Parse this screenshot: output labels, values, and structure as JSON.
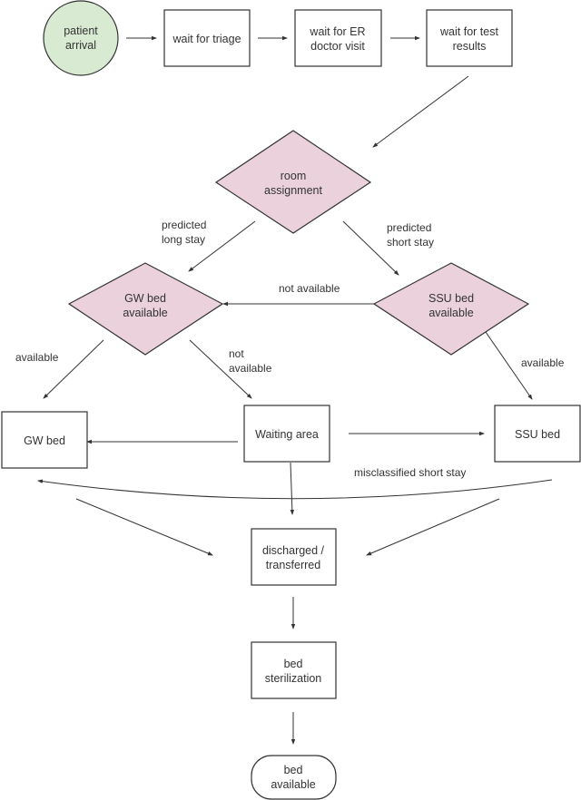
{
  "colors": {
    "start_fill": "#d9ead3",
    "decision_fill": "#ead1dc",
    "process_fill": "#ffffff",
    "stroke": "#333333"
  },
  "nodes": {
    "patient_arrival": [
      "patient",
      "arrival"
    ],
    "wait_triage": [
      "wait for triage"
    ],
    "wait_er": [
      "wait for ER",
      "doctor visit"
    ],
    "wait_test": [
      "wait for test",
      "results"
    ],
    "room_assignment": [
      "room",
      "assignment"
    ],
    "gw_bed_available": [
      "GW bed",
      "available"
    ],
    "ssu_bed_available": [
      "SSU bed",
      "available"
    ],
    "gw_bed": [
      "GW bed"
    ],
    "waiting_area": [
      "Waiting area"
    ],
    "ssu_bed": [
      "SSU bed"
    ],
    "discharged": [
      "discharged /",
      "transferred"
    ],
    "sterilization": [
      "bed",
      "sterilization"
    ],
    "bed_available": [
      "bed",
      "available"
    ]
  },
  "edge_labels": {
    "predicted_long": [
      "predicted",
      "long stay"
    ],
    "predicted_short": [
      "predicted",
      "short stay"
    ],
    "ssu_not_available": [
      "not available"
    ],
    "gw_available": [
      "available"
    ],
    "gw_not_available": [
      "not",
      "available"
    ],
    "ssu_available": [
      "available"
    ],
    "misclassified": [
      "misclassified short stay"
    ]
  }
}
